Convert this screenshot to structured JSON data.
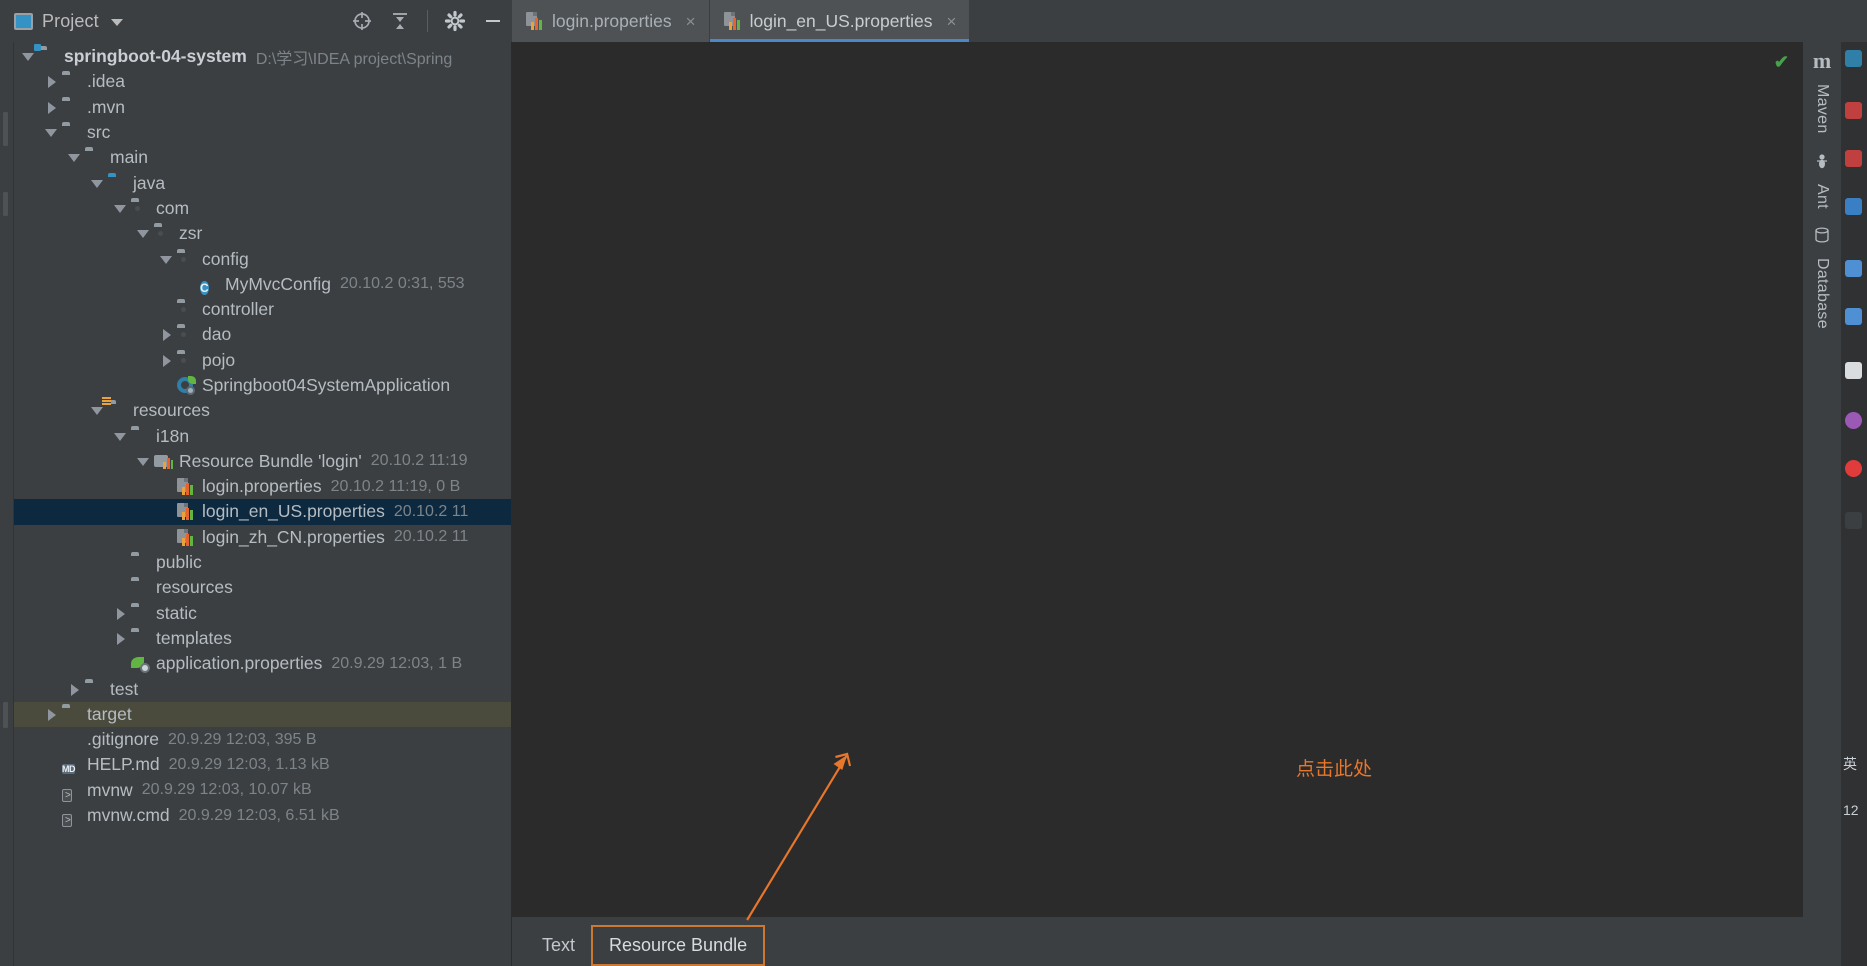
{
  "window": {
    "theme_bg": "#3c3f41",
    "editor_bg": "#2b2b2b",
    "accent": "#4a88c7",
    "selection_bg": "#0d293f"
  },
  "tool_window": {
    "title": "Project",
    "icons": [
      "project-icon",
      "chevron-down-icon",
      "locate-icon",
      "collapse-all-icon",
      "settings-gear-icon",
      "hide-icon"
    ]
  },
  "editor_tabs": [
    {
      "label": "login.properties",
      "icon": "properties-file-icon",
      "active": false,
      "close": "×"
    },
    {
      "label": "login_en_US.properties",
      "icon": "properties-file-icon",
      "active": true,
      "close": "×"
    }
  ],
  "project_tree": [
    {
      "depth": 0,
      "arrow": "down",
      "icon": "module-folder-icon",
      "label": "springboot-04-system",
      "meta": "D:\\学习\\IDEA project\\Spring",
      "bold": true
    },
    {
      "depth": 1,
      "arrow": "right",
      "icon": "folder-icon",
      "label": ".idea",
      "meta": ""
    },
    {
      "depth": 1,
      "arrow": "right",
      "icon": "folder-icon",
      "label": ".mvn",
      "meta": ""
    },
    {
      "depth": 1,
      "arrow": "down",
      "icon": "folder-icon",
      "label": "src",
      "meta": ""
    },
    {
      "depth": 2,
      "arrow": "down",
      "icon": "folder-icon",
      "label": "main",
      "meta": ""
    },
    {
      "depth": 3,
      "arrow": "down",
      "icon": "source-folder-icon",
      "label": "java",
      "meta": ""
    },
    {
      "depth": 4,
      "arrow": "down",
      "icon": "package-icon",
      "label": "com",
      "meta": ""
    },
    {
      "depth": 5,
      "arrow": "down",
      "icon": "package-icon",
      "label": "zsr",
      "meta": ""
    },
    {
      "depth": 6,
      "arrow": "down",
      "icon": "package-icon",
      "label": "config",
      "meta": ""
    },
    {
      "depth": 7,
      "arrow": "none",
      "icon": "java-class-icon",
      "label": "MyMvcConfig",
      "meta": "20.10.2 0:31, 553"
    },
    {
      "depth": 6,
      "arrow": "none",
      "icon": "package-icon",
      "label": "controller",
      "meta": ""
    },
    {
      "depth": 6,
      "arrow": "right",
      "icon": "package-icon",
      "label": "dao",
      "meta": ""
    },
    {
      "depth": 6,
      "arrow": "right",
      "icon": "package-icon",
      "label": "pojo",
      "meta": ""
    },
    {
      "depth": 6,
      "arrow": "none",
      "icon": "spring-boot-class-icon",
      "label": "Springboot04SystemApplication",
      "meta": ""
    },
    {
      "depth": 3,
      "arrow": "down",
      "icon": "resources-folder-icon",
      "label": "resources",
      "meta": ""
    },
    {
      "depth": 4,
      "arrow": "down",
      "icon": "folder-icon",
      "label": "i18n",
      "meta": ""
    },
    {
      "depth": 5,
      "arrow": "down",
      "icon": "resource-bundle-icon",
      "label": "Resource Bundle 'login'",
      "meta": "20.10.2 11:19"
    },
    {
      "depth": 6,
      "arrow": "none",
      "icon": "properties-file-icon",
      "label": "login.properties",
      "meta": "20.10.2 11:19, 0 B"
    },
    {
      "depth": 6,
      "arrow": "none",
      "icon": "properties-file-icon",
      "label": "login_en_US.properties",
      "meta": "20.10.2 11",
      "selected": true
    },
    {
      "depth": 6,
      "arrow": "none",
      "icon": "properties-file-icon",
      "label": "login_zh_CN.properties",
      "meta": "20.10.2 11"
    },
    {
      "depth": 4,
      "arrow": "none",
      "icon": "folder-icon",
      "label": "public",
      "meta": ""
    },
    {
      "depth": 4,
      "arrow": "none",
      "icon": "folder-icon",
      "label": "resources",
      "meta": ""
    },
    {
      "depth": 4,
      "arrow": "right",
      "icon": "folder-icon",
      "label": "static",
      "meta": ""
    },
    {
      "depth": 4,
      "arrow": "right",
      "icon": "folder-icon",
      "label": "templates",
      "meta": ""
    },
    {
      "depth": 4,
      "arrow": "none",
      "icon": "spring-properties-icon",
      "label": "application.properties",
      "meta": "20.9.29 12:03, 1 B"
    },
    {
      "depth": 2,
      "arrow": "right",
      "icon": "folder-icon",
      "label": "test",
      "meta": ""
    },
    {
      "depth": 1,
      "arrow": "right",
      "icon": "target-folder-icon",
      "label": "target",
      "meta": "",
      "highlighted": true
    },
    {
      "depth": 1,
      "arrow": "none",
      "icon": "gitignore-icon",
      "label": ".gitignore",
      "meta": "20.9.29 12:03, 395 B"
    },
    {
      "depth": 1,
      "arrow": "none",
      "icon": "markdown-icon",
      "label": "HELP.md",
      "meta": "20.9.29 12:03, 1.13 kB"
    },
    {
      "depth": 1,
      "arrow": "none",
      "icon": "shell-script-icon",
      "label": "mvnw",
      "meta": "20.9.29 12:03, 10.07 kB"
    },
    {
      "depth": 1,
      "arrow": "none",
      "icon": "shell-script-icon",
      "label": "mvnw.cmd",
      "meta": "20.9.29 12:03, 6.51 kB"
    }
  ],
  "editor": {
    "inspection_status": "✔",
    "bottom_tabs": [
      {
        "label": "Text",
        "boxed": false
      },
      {
        "label": "Resource Bundle",
        "boxed": true
      }
    ]
  },
  "annotation": {
    "text": "点击此处",
    "color": "#e8762b"
  },
  "right_tool_strip": [
    {
      "label": "Maven",
      "icon": "maven-m-icon"
    },
    {
      "label": "Ant",
      "icon": "ant-icon"
    },
    {
      "label": "Database",
      "icon": "database-icon"
    }
  ],
  "ime_indicator": {
    "label": "英",
    "clock": "12"
  }
}
